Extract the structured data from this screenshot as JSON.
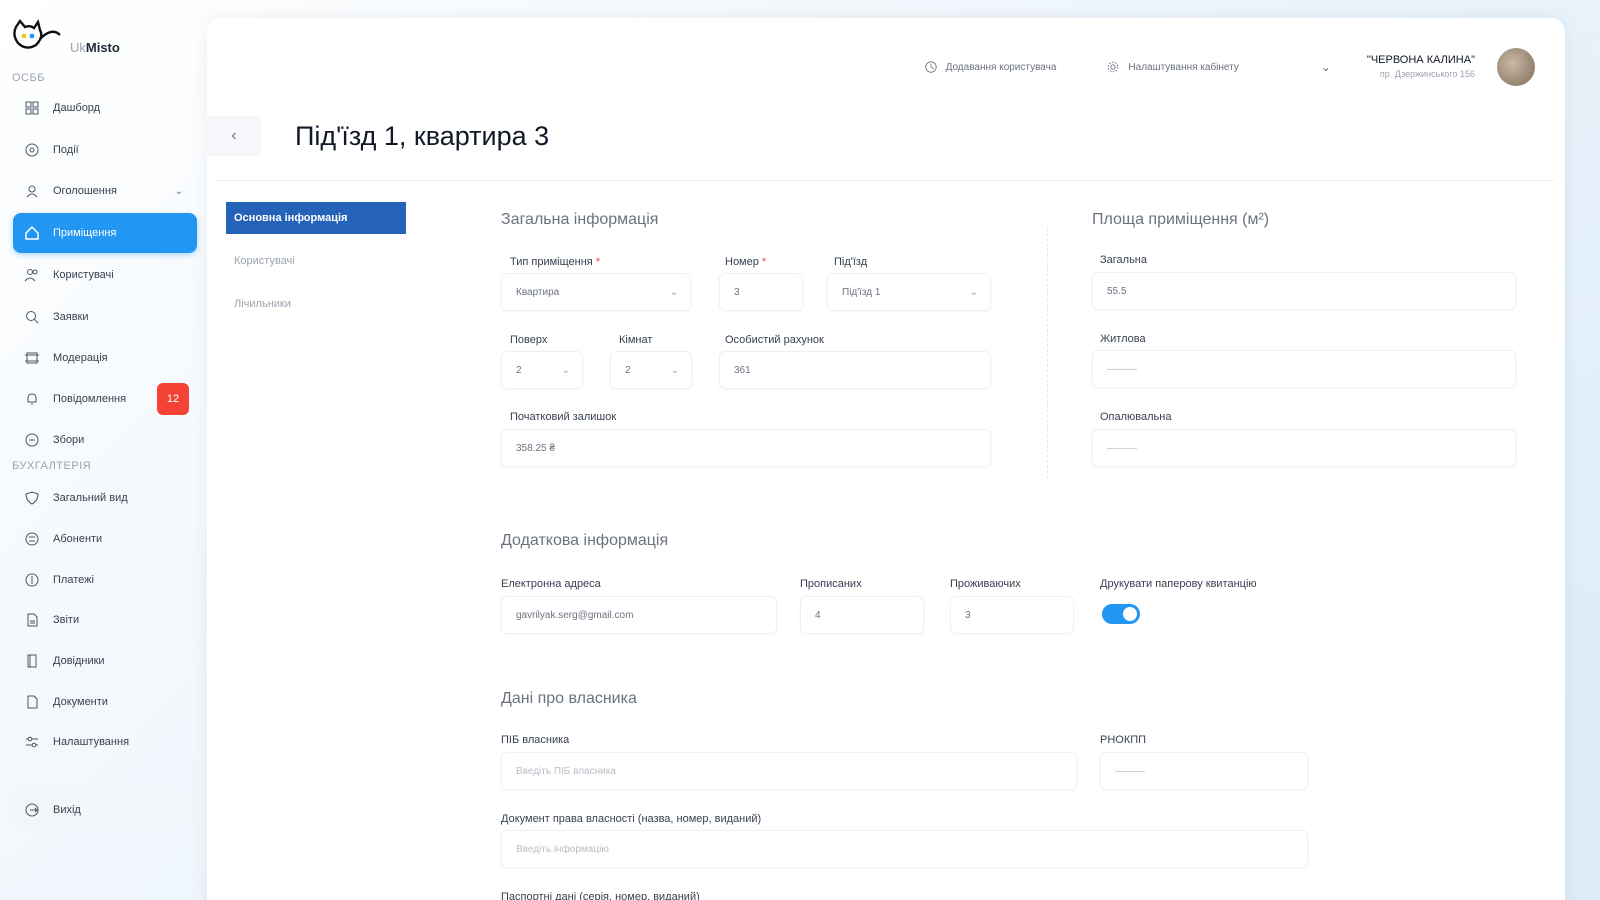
{
  "brand": {
    "prefix": "Uk",
    "name": "Misto"
  },
  "sidebar": {
    "section_main": "ОСББ",
    "section_accounting": "БУХГАЛТЕРІЯ",
    "items": [
      {
        "label": "Дашборд"
      },
      {
        "label": "Події"
      },
      {
        "label": "Оголошення"
      },
      {
        "label": "Приміщення"
      },
      {
        "label": "Користувачі"
      },
      {
        "label": "Заявки"
      },
      {
        "label": "Модерація"
      },
      {
        "label": "Повідомлення",
        "badge": "12"
      },
      {
        "label": "Збори"
      },
      {
        "label": "Загальний вид"
      },
      {
        "label": "Абоненти"
      },
      {
        "label": "Платежі"
      },
      {
        "label": "Звіти"
      },
      {
        "label": "Довідники"
      },
      {
        "label": "Документи"
      },
      {
        "label": "Налаштування"
      }
    ],
    "logout": "Вихід"
  },
  "topbar": {
    "add_user": "Додавання користувача",
    "cabinet_settings": "Налаштування кабінету",
    "org_name": "\"ЧЕРВОНА КАЛИНА\"",
    "org_address": "пр. Дзержинського 156"
  },
  "page": {
    "title": "Під'їзд 1, квартира 3",
    "back": "‹"
  },
  "tabs": [
    "Основна інформація",
    "Користувачі",
    "Лічильники"
  ],
  "general": {
    "title": "Загальна інформація",
    "type_label": "Тип приміщення",
    "type_value": "Квартира",
    "number_label": "Номер",
    "number_value": "3",
    "entrance_label": "Під'їзд",
    "entrance_value": "Під'їзд 1",
    "floor_label": "Поверх",
    "floor_value": "2",
    "rooms_label": "Кімнат",
    "rooms_value": "2",
    "account_label": "Особистий рахунок",
    "account_value": "361",
    "balance_label": "Початковий залишок",
    "balance_value": "358.25 ₴"
  },
  "area": {
    "title": "Площа приміщення (м²)",
    "total_label": "Загальна",
    "total_value": "55.5",
    "living_label": "Житлова",
    "living_value": "———",
    "heated_label": "Опалювальна",
    "heated_value": "———"
  },
  "extra": {
    "title": "Додаткова інформація",
    "email_label": "Електронна адреса",
    "email_value": "gavrilyak.serg@gmail.com",
    "registered_label": "Прописаних",
    "registered_value": "4",
    "residents_label": "Проживаючих",
    "residents_value": "3",
    "paper_label": "Друкувати паперову квитанцію"
  },
  "owner": {
    "title": "Дані про власника",
    "name_label": "ПІБ власника",
    "name_placeholder": "Введіть ПІБ власника",
    "tax_label": "РНОКПП",
    "tax_value": "———",
    "doc_label": "Документ права власності (назва, номер, виданий)",
    "doc_placeholder": "Введіть інформацію",
    "passport_label": "Паспортні дані (серія, номер, виданий)"
  }
}
